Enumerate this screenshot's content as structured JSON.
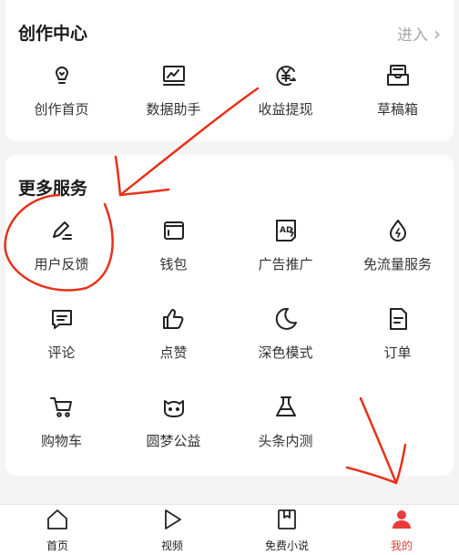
{
  "creator_center": {
    "title": "创作中心",
    "enter_label": "进入",
    "items": [
      {
        "label": "创作首页",
        "icon": "lightbulb-icon"
      },
      {
        "label": "数据助手",
        "icon": "chart-icon"
      },
      {
        "label": "收益提现",
        "icon": "yen-icon"
      },
      {
        "label": "草稿箱",
        "icon": "draft-box-icon"
      }
    ]
  },
  "more_services": {
    "title": "更多服务",
    "items": [
      {
        "label": "用户反馈",
        "icon": "pencil-icon"
      },
      {
        "label": "钱包",
        "icon": "wallet-icon"
      },
      {
        "label": "广告推广",
        "icon": "ad-icon"
      },
      {
        "label": "免流量服务",
        "icon": "drop-icon"
      },
      {
        "label": "评论",
        "icon": "comment-icon"
      },
      {
        "label": "点赞",
        "icon": "thumbs-up-icon"
      },
      {
        "label": "深色模式",
        "icon": "moon-icon"
      },
      {
        "label": "订单",
        "icon": "order-icon"
      },
      {
        "label": "购物车",
        "icon": "cart-icon"
      },
      {
        "label": "圆梦公益",
        "icon": "charity-icon"
      },
      {
        "label": "头条内测",
        "icon": "flask-icon"
      }
    ]
  },
  "tabbar": {
    "items": [
      {
        "label": "首页",
        "icon": "home-icon"
      },
      {
        "label": "视频",
        "icon": "play-icon"
      },
      {
        "label": "免费小说",
        "icon": "book-icon"
      },
      {
        "label": "我的",
        "icon": "profile-icon",
        "active": true
      }
    ]
  },
  "colors": {
    "accent": "#e83b3b",
    "annotation": "#e8311a",
    "background": "#f4f4f4"
  }
}
